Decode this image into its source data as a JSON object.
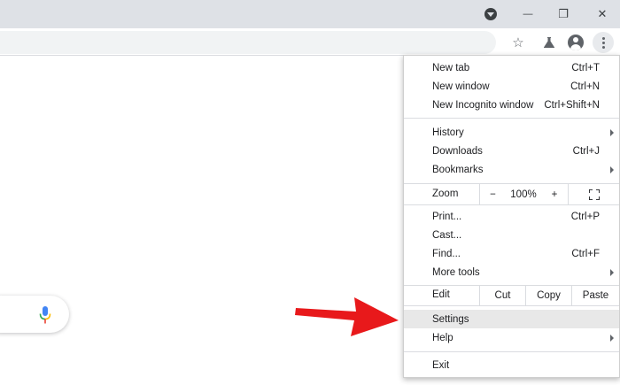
{
  "window": {
    "minimize_glyph": "—",
    "restore_glyph": "❐",
    "close_glyph": "✕"
  },
  "toolbar": {
    "bookmark_star_glyph": "☆",
    "extension_glyph": "⚗"
  },
  "menu": {
    "new_tab": {
      "label": "New tab",
      "shortcut": "Ctrl+T"
    },
    "new_window": {
      "label": "New window",
      "shortcut": "Ctrl+N"
    },
    "new_incognito": {
      "label": "New Incognito window",
      "shortcut": "Ctrl+Shift+N"
    },
    "history": {
      "label": "History"
    },
    "downloads": {
      "label": "Downloads",
      "shortcut": "Ctrl+J"
    },
    "bookmarks": {
      "label": "Bookmarks"
    },
    "zoom": {
      "label": "Zoom",
      "minus": "−",
      "value": "100%",
      "plus": "+",
      "fullscreen": "⛶"
    },
    "print": {
      "label": "Print...",
      "shortcut": "Ctrl+P"
    },
    "cast": {
      "label": "Cast..."
    },
    "find": {
      "label": "Find...",
      "shortcut": "Ctrl+F"
    },
    "more_tools": {
      "label": "More tools"
    },
    "edit": {
      "label": "Edit",
      "cut": "Cut",
      "copy": "Copy",
      "paste": "Paste"
    },
    "settings": {
      "label": "Settings"
    },
    "help": {
      "label": "Help"
    },
    "exit": {
      "label": "Exit"
    }
  },
  "colors": {
    "titlebar": "#dee1e6",
    "arrow": "#e8191b",
    "highlight": "#e8e8e8"
  }
}
